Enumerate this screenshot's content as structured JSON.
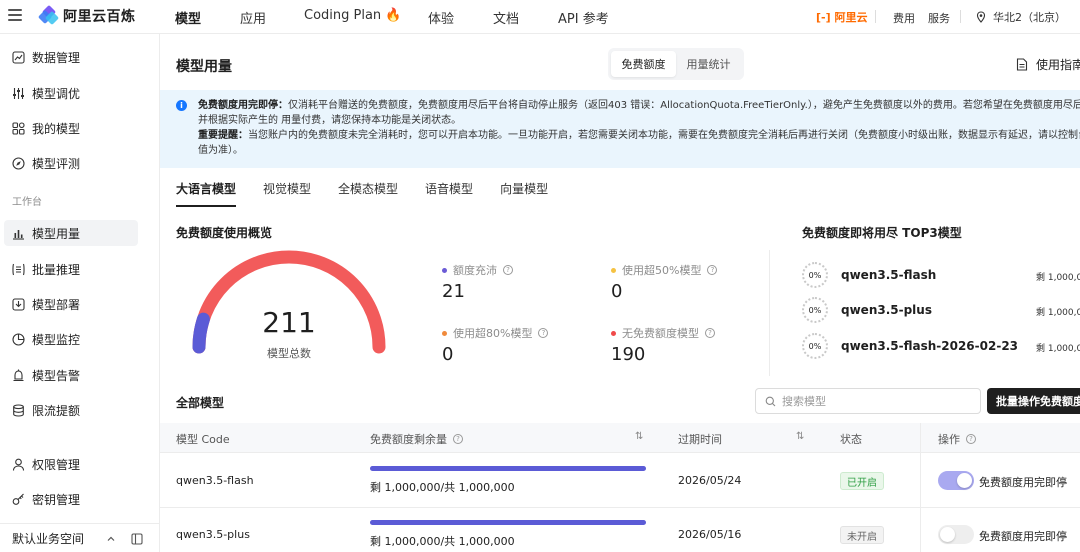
{
  "brand": {
    "name": "阿里云百炼",
    "aliyun": "阿里云"
  },
  "nav": {
    "items": [
      "模型",
      "应用",
      "Coding Plan 🔥",
      "体验",
      "文档",
      "API 参考"
    ],
    "links": {
      "cost": "费用",
      "service": "服务"
    },
    "region": "华北2（北京）"
  },
  "sidebar": {
    "items": [
      "数据管理",
      "模型调优",
      "我的模型",
      "模型评测"
    ],
    "section": "工作台",
    "work_items": [
      "模型用量",
      "批量推理",
      "模型部署",
      "模型监控",
      "模型告警",
      "限流提额"
    ],
    "admin_items": [
      "权限管理",
      "密钥管理"
    ],
    "footer": "默认业务空间"
  },
  "page": {
    "title": "模型用量",
    "segments": [
      "免费额度",
      "用量统计"
    ],
    "guide": "使用指南"
  },
  "notice": {
    "line1_bold": "免费额度用完即停：",
    "line1": "仅消耗平台赠送的免费额度，免费额度用尽后平台将自动停止服务（返回403 错误：AllocationQuota.FreeTierOnly.），避免产生免费额度以外的费用。若您希望在免费额度用尽后仍继续使用",
    "line2": "并根据实际产生的 用量付费，请您保持本功能是关闭状态。",
    "line3_bold": "重要提醒：",
    "line3": "当您账户内的免费额度未完全消耗时，您可以开启本功能。一旦功能开启，若您需要关闭本功能，需要在免费额度完全消耗后再进行关闭（免费额度小时级出账，数据显示有延迟，请以控制台显示",
    "line4": "值为准）。"
  },
  "tabs": [
    "大语言模型",
    "视觉模型",
    "全模态模型",
    "语音模型",
    "向量模型"
  ],
  "overview": {
    "title": "免费额度使用概览",
    "total": "211",
    "total_label": "模型总数",
    "stats": [
      {
        "label": "额度充沛",
        "value": "21",
        "color": "#6b5bd6"
      },
      {
        "label": "使用超50%模型",
        "value": "0",
        "color": "#f5c242"
      },
      {
        "label": "使用超80%模型",
        "value": "0",
        "color": "#f08a3c"
      },
      {
        "label": "无免费额度模型",
        "value": "190",
        "color": "#f04a4a"
      }
    ],
    "gauge_fraction": 0.1
  },
  "top3": {
    "title": "免费额度即将用尽 TOP3模型",
    "items": [
      {
        "pct": "0%",
        "name": "qwen3.5-flash",
        "remaining": "剩 1,000,0"
      },
      {
        "pct": "0%",
        "name": "qwen3.5-plus",
        "remaining": "剩 1,000,0"
      },
      {
        "pct": "0%",
        "name": "qwen3.5-flash-2026-02-23",
        "remaining": "剩 1,000,0"
      }
    ]
  },
  "list": {
    "title": "全部模型",
    "search_placeholder": "搜索模型",
    "bulk_button": "批量操作免费额度",
    "columns": {
      "code": "模型 Code",
      "remaining": "免费额度剩余量",
      "expire": "过期时间",
      "status": "状态",
      "action": "操作"
    },
    "rows": [
      {
        "code": "qwen3.5-flash",
        "remaining_text": "剩 1,000,000/共 1,000,000",
        "remaining_fraction": 1.0,
        "expire": "2026/05/24",
        "status": "已开启",
        "status_on": true,
        "toggle_label": "免费额度用完即停",
        "toggle_on": true
      },
      {
        "code": "qwen3.5-plus",
        "remaining_text": "剩 1,000,000/共 1,000,000",
        "remaining_fraction": 1.0,
        "expire": "2026/05/16",
        "status": "未开启",
        "status_on": false,
        "toggle_label": "免费额度用完即停",
        "toggle_on": false
      }
    ]
  }
}
